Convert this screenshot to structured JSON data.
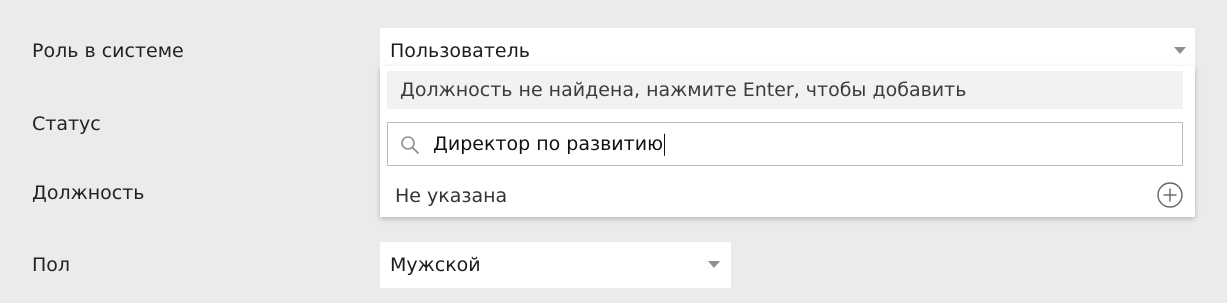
{
  "fields": {
    "role": {
      "label": "Роль в системе",
      "value": "Пользователь"
    },
    "status": {
      "label": "Статус"
    },
    "position": {
      "label": "Должность"
    },
    "gender": {
      "label": "Пол",
      "value": "Мужской"
    }
  },
  "position_dropdown": {
    "hint": "Должность не найдена, нажмите Enter, чтобы добавить",
    "search_value": "Директор по развитию",
    "option_label": "Не указана"
  },
  "icons": {
    "search": "search-icon",
    "add": "plus-circle-icon",
    "caret": "caret-down-icon"
  },
  "colors": {
    "background": "#ebebeb",
    "field_background": "#ffffff",
    "hint_background": "#f2f2f2",
    "icon_gray": "#8f8f8f"
  }
}
